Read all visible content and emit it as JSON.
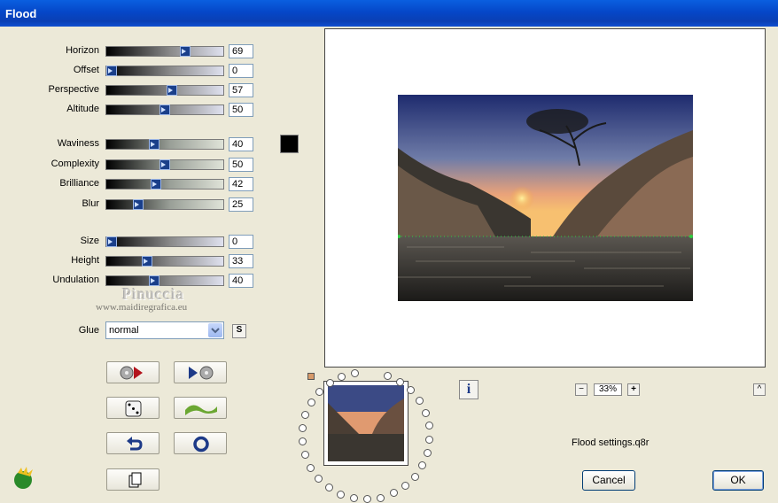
{
  "window": {
    "title": "Flood"
  },
  "groups": [
    [
      {
        "label": "Horizon",
        "value": "69",
        "pct": 0.69,
        "style": "a"
      },
      {
        "label": "Offset",
        "value": "0",
        "pct": 0.0,
        "style": "a"
      },
      {
        "label": "Perspective",
        "value": "57",
        "pct": 0.57,
        "style": "a"
      },
      {
        "label": "Altitude",
        "value": "50",
        "pct": 0.5,
        "style": "a"
      }
    ],
    [
      {
        "label": "Waviness",
        "value": "40",
        "pct": 0.4,
        "style": "b"
      },
      {
        "label": "Complexity",
        "value": "50",
        "pct": 0.5,
        "style": "b"
      },
      {
        "label": "Brilliance",
        "value": "42",
        "pct": 0.42,
        "style": "b"
      },
      {
        "label": "Blur",
        "value": "25",
        "pct": 0.25,
        "style": "b"
      }
    ],
    [
      {
        "label": "Size",
        "value": "0",
        "pct": 0.0,
        "style": "a"
      },
      {
        "label": "Height",
        "value": "33",
        "pct": 0.33,
        "style": "a"
      },
      {
        "label": "Undulation",
        "value": "40",
        "pct": 0.4,
        "style": "a"
      }
    ]
  ],
  "color_swatch": "#000000",
  "watermark": {
    "name": "Pinuccia",
    "site": "www.maidiregrafica.eu"
  },
  "glue": {
    "label": "Glue",
    "value": "normal",
    "s_button": "S"
  },
  "zoom": {
    "minus": "−",
    "value": "33%",
    "plus": "+"
  },
  "settings_file": "Flood settings.q8r",
  "buttons": {
    "cancel": "Cancel",
    "ok": "OK",
    "up": "^",
    "info": "i"
  }
}
